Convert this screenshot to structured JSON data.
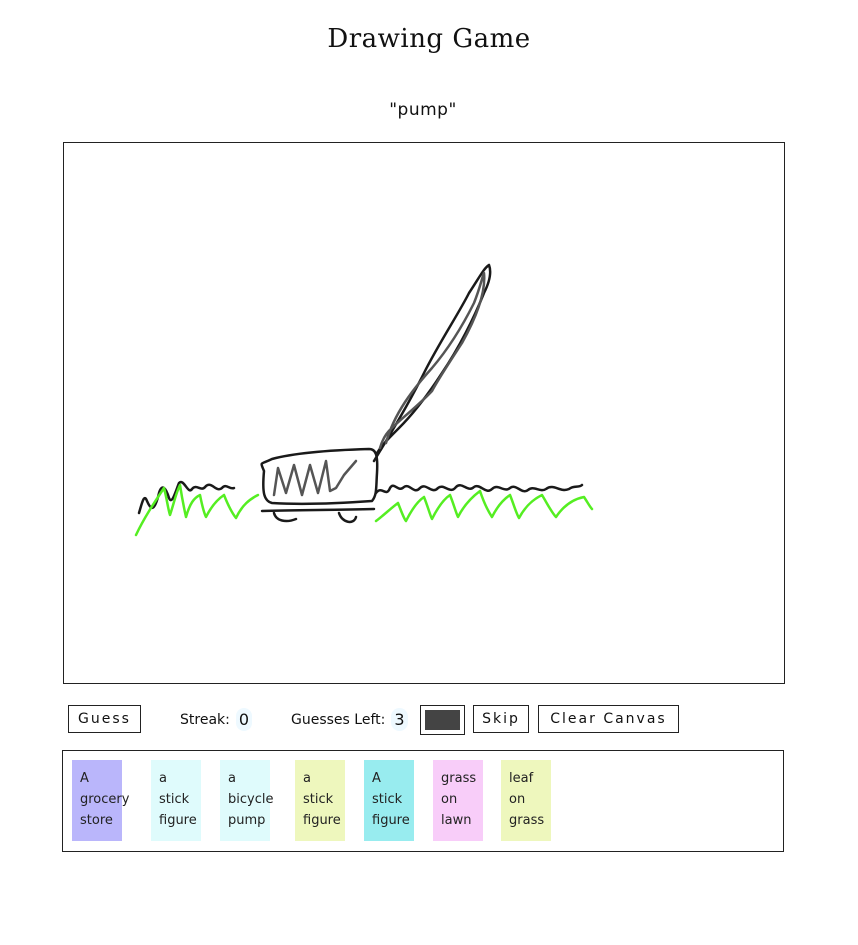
{
  "title": "Drawing Game",
  "prompt": "\"pump\"",
  "buttons": {
    "guess": "Guess",
    "skip": "Skip",
    "clear": "Clear Canvas"
  },
  "stats": {
    "streak_label": "Streak:",
    "streak_value": "0",
    "guesses_left_label": "Guesses Left:",
    "guesses_left_value": "3"
  },
  "current_color": "#444444",
  "guesses": [
    {
      "text": "A grocery store",
      "color": "#bab6fb"
    },
    {
      "text": "a stick figure",
      "color": "#dffbfc"
    },
    {
      "text": "a bicycle pump",
      "color": "#dffbfc"
    },
    {
      "text": "a stick figure",
      "color": "#eef7bd"
    },
    {
      "text": "A stick figure",
      "color": "#98ecef"
    },
    {
      "text": "grass on lawn",
      "color": "#f8cdf9"
    },
    {
      "text": "leaf on grass",
      "color": "#eef7bd"
    }
  ]
}
